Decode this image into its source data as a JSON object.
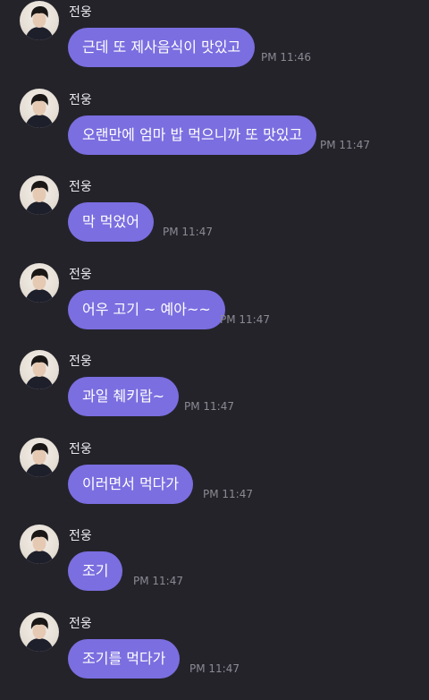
{
  "messages": [
    {
      "sender": "전웅",
      "text": "근데 또 제사음식이 맛있고",
      "time": "PM 11:46"
    },
    {
      "sender": "전웅",
      "text": "오랜만에 엄마 밥 먹으니까 또 맛있고",
      "time": "PM 11:47"
    },
    {
      "sender": "전웅",
      "text": "막 먹었어",
      "time": "PM 11:47"
    },
    {
      "sender": "전웅",
      "text": "어우 고기 ~ 예아~~",
      "time": "PM 11:47"
    },
    {
      "sender": "전웅",
      "text": "과일 췌키랍~",
      "time": "PM 11:47"
    },
    {
      "sender": "전웅",
      "text": "이러면서 먹다가",
      "time": "PM 11:47"
    },
    {
      "sender": "전웅",
      "text": "조기",
      "time": "PM 11:47"
    },
    {
      "sender": "전웅",
      "text": "조기를 먹다가",
      "time": "PM 11:47"
    }
  ],
  "colors": {
    "background": "#24232a",
    "bubble": "#7b6ee0",
    "time": "#8b8a93"
  }
}
